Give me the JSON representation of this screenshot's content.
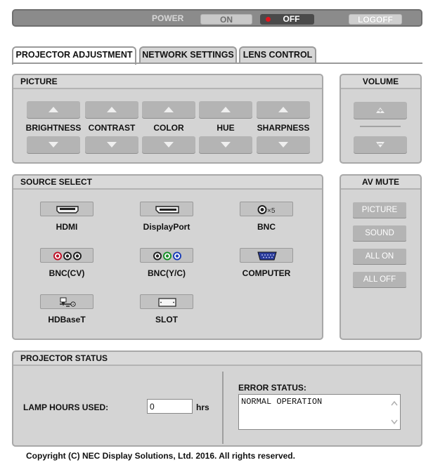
{
  "power": {
    "label": "POWER",
    "on_label": "ON",
    "off_label": "OFF",
    "state": "off",
    "logoff_label": "LOGOFF"
  },
  "tabs": [
    {
      "label": "PROJECTOR ADJUSTMENT",
      "active": true
    },
    {
      "label": "NETWORK SETTINGS",
      "active": false
    },
    {
      "label": "LENS CONTROL",
      "active": false
    }
  ],
  "picture": {
    "title": "PICTURE",
    "controls": [
      "BRIGHTNESS",
      "CONTRAST",
      "COLOR",
      "HUE",
      "SHARPNESS"
    ],
    "up_icon": "triangle-up-icon",
    "down_icon": "triangle-down-icon"
  },
  "volume": {
    "title": "VOLUME",
    "up_icon": "volume-up-icon",
    "down_icon": "volume-down-icon"
  },
  "source_select": {
    "title": "SOURCE SELECT",
    "sources": [
      {
        "label": "HDMI",
        "icon": "hdmi-port-icon"
      },
      {
        "label": "DisplayPort",
        "icon": "displayport-icon"
      },
      {
        "label": "BNC",
        "icon": "bnc-x5-icon"
      },
      {
        "label": "BNC(CV)",
        "icon": "bnc-cv-icon"
      },
      {
        "label": "BNC(Y/C)",
        "icon": "bnc-yc-icon"
      },
      {
        "label": "COMPUTER",
        "icon": "vga-port-icon"
      },
      {
        "label": "HDBaseT",
        "icon": "hdbaset-icon"
      },
      {
        "label": "SLOT",
        "icon": "slot-icon"
      }
    ]
  },
  "av_mute": {
    "title": "AV MUTE",
    "buttons": [
      "PICTURE",
      "SOUND",
      "ALL ON",
      "ALL OFF"
    ]
  },
  "projector_status": {
    "title": "PROJECTOR STATUS",
    "lamp_hours_label": "LAMP HOURS USED:",
    "lamp_hours_value": "0",
    "lamp_hours_unit": "hrs",
    "error_status_label": "ERROR STATUS:",
    "error_status_value": "NORMAL OPERATION"
  },
  "footer": {
    "copyright": "Copyright (C) NEC Display Solutions, Ltd. 2016. All rights reserved."
  },
  "colors": {
    "panel_bg": "#d4d4d4",
    "button_gray": "#b4b4b4",
    "power_off_indicator": "#e3141d"
  }
}
